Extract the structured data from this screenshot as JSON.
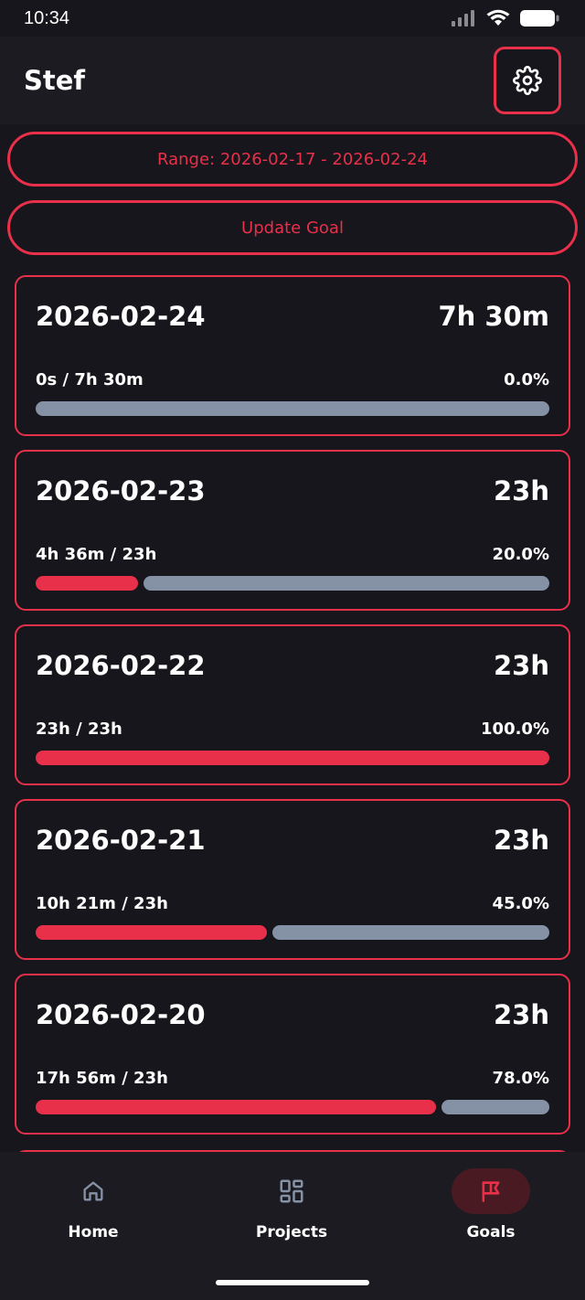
{
  "status_bar": {
    "time": "10:34"
  },
  "header": {
    "title": "Stef",
    "settings_icon": "gear-icon"
  },
  "range_button": {
    "label": "Range: 2026-02-17 - 2026-02-24"
  },
  "update_button": {
    "label": "Update Goal"
  },
  "cards": [
    {
      "date": "2026-02-24",
      "goal": "7h 30m",
      "progress_text": "0s / 7h 30m",
      "percent_label": "0.0%",
      "percent": 0.0
    },
    {
      "date": "2026-02-23",
      "goal": "23h",
      "progress_text": "4h 36m / 23h",
      "percent_label": "20.0%",
      "percent": 20.0
    },
    {
      "date": "2026-02-22",
      "goal": "23h",
      "progress_text": "23h / 23h",
      "percent_label": "100.0%",
      "percent": 100.0
    },
    {
      "date": "2026-02-21",
      "goal": "23h",
      "progress_text": "10h 21m / 23h",
      "percent_label": "45.0%",
      "percent": 45.0
    },
    {
      "date": "2026-02-20",
      "goal": "23h",
      "progress_text": "17h 56m / 23h",
      "percent_label": "78.0%",
      "percent": 78.0
    }
  ],
  "nav": {
    "items": [
      {
        "label": "Home",
        "icon": "home-icon",
        "active": false
      },
      {
        "label": "Projects",
        "icon": "grid-icon",
        "active": false
      },
      {
        "label": "Goals",
        "icon": "flag-icon",
        "active": true
      }
    ]
  },
  "colors": {
    "accent": "#e8304a",
    "track": "#8592a6",
    "background": "#16161c"
  }
}
